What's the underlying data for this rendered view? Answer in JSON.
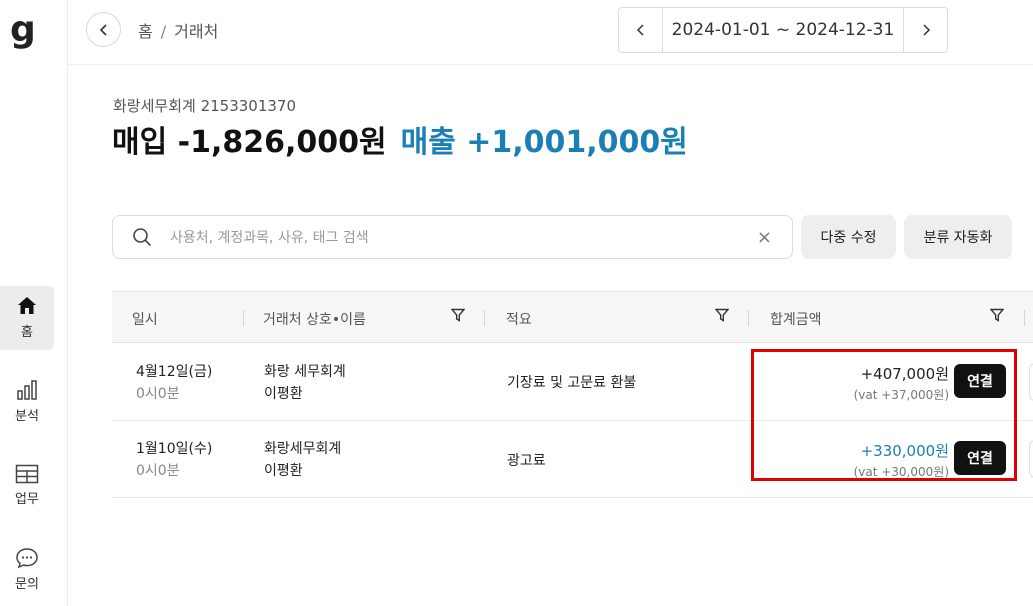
{
  "app": {
    "logo_letter": "g"
  },
  "sidebar": {
    "items": [
      {
        "label": "홈",
        "icon": "home-icon",
        "active": true
      },
      {
        "label": "분석",
        "icon": "bar-chart-icon",
        "active": false
      },
      {
        "label": "업무",
        "icon": "table-icon",
        "active": false
      },
      {
        "label": "문의",
        "icon": "chat-icon",
        "active": false
      }
    ]
  },
  "topbar": {
    "breadcrumb": {
      "home": "홈",
      "separator": "/",
      "current": "거래처"
    },
    "date_range": "2024-01-01 ~ 2024-12-31"
  },
  "header": {
    "company": "화랑세무회계 2153301370",
    "purchase_total": "매입 -1,826,000원",
    "sales_total": "매출 +1,001,000원"
  },
  "search": {
    "placeholder": "사용처, 계정과목, 사유, 태그 검색",
    "value": "",
    "clear_symbol": "×"
  },
  "actions": {
    "bulk_edit": "다중 수정",
    "auto_classify": "분류 자동화"
  },
  "table": {
    "columns": [
      "일시",
      "거래처 상호•이름",
      "적요",
      "합계금액"
    ],
    "rows": [
      {
        "date": "4월12일(금)",
        "time": "0시0분",
        "vendor": "화랑 세무회계",
        "person": "이평환",
        "memo": "기장료 및 고문료 환불",
        "amount": "+407,000원",
        "vat": "(vat +37,000원)",
        "amount_color": "#222222",
        "link_label": "연결"
      },
      {
        "date": "1월10일(수)",
        "time": "0시0분",
        "vendor": "화랑세무회계",
        "person": "이평환",
        "memo": "광고료",
        "amount": "+330,000원",
        "vat": "(vat +30,000원)",
        "amount_color": "#1a7fb5",
        "link_label": "연결"
      }
    ]
  },
  "colors": {
    "accent": "#1a7fb5",
    "highlight": "#e10000"
  }
}
